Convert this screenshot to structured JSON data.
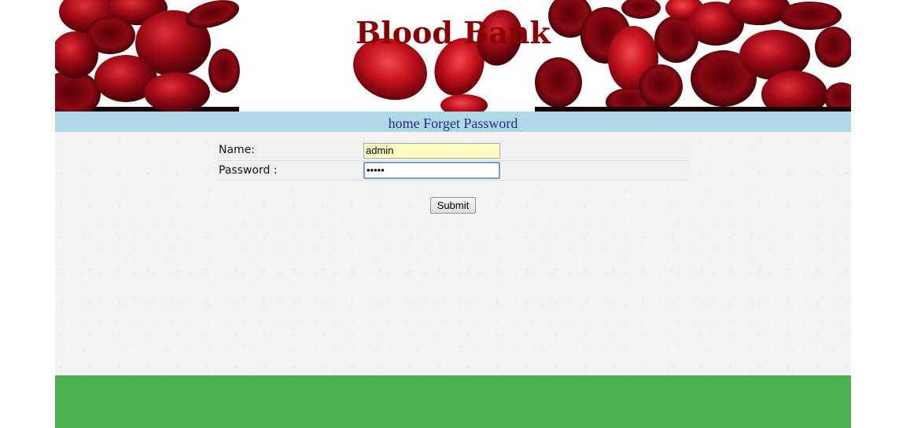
{
  "header": {
    "title": "Blood Bank"
  },
  "nav": {
    "home_label": "home",
    "forget_password_label": "Forget Password"
  },
  "form": {
    "name_label": "Name:",
    "name_value": "admin",
    "password_label": "Password :",
    "password_value": "admin",
    "submit_label": "Submit"
  },
  "colors": {
    "title": "#8b0000",
    "nav_bar": "#add8e6",
    "nav_text": "#2e2a8a",
    "footer": "#4caf50",
    "autofill": "#fafcc0"
  }
}
